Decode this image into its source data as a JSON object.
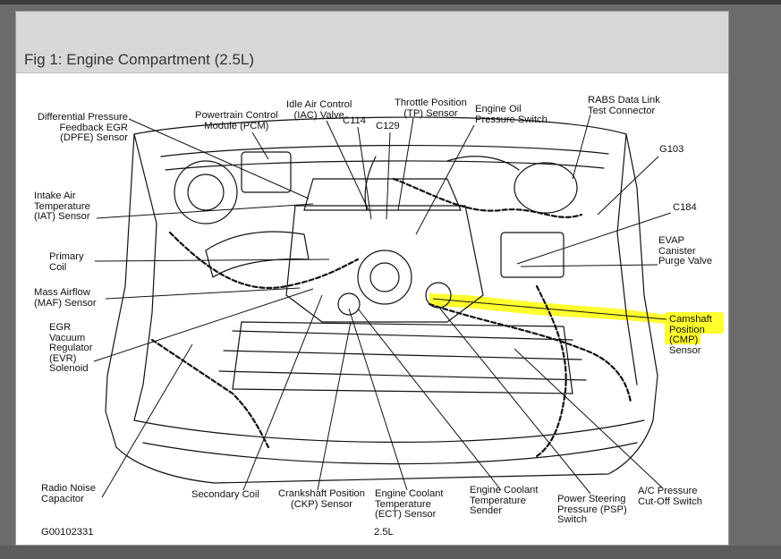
{
  "figure": {
    "title": "Fig 1: Engine Compartment (2.5L)",
    "code": "G00102331",
    "engine": "2.5L"
  },
  "labels": {
    "dpfe": "Differential Pressure\nFeedback EGR\n(DPFE) Sensor",
    "pcm": "Powertrain Control\nModule (PCM)",
    "iac": "Idle Air Control\n(IAC) Valve",
    "c114": "C114",
    "c129": "C129",
    "tp": "Throttle Position\n(TP) Sensor",
    "oil": "Engine Oil\nPressure Switch",
    "rabs": "RABS Data Link\nTest Connector",
    "g103": "G103",
    "iat": "Intake Air\nTemperature\n(IAT) Sensor",
    "c184": "C184",
    "evap": "EVAP\nCanister\nPurge Valve",
    "coil": "Primary\nCoil",
    "maf": "Mass Airflow\n(MAF) Sensor",
    "cmp": "Camshaft\nPosition\n(CMP)\nSensor",
    "egr": "EGR\nVacuum\nRegulator\n(EVR)\nSolenoid",
    "radio": "Radio Noise\nCapacitor",
    "secondary": "Secondary Coil",
    "ckp": "Crankshaft Position\n(CKP) Sensor",
    "ect": "Engine Coolant\nTemperature\n(ECT) Sensor",
    "sender": "Engine Coolant\nTemperature\nSender",
    "psp": "Power Steering\nPressure (PSP)\nSwitch",
    "ac": "A/C Pressure\nCut-Off Switch"
  },
  "colors": {
    "highlight": "#ffff2e",
    "header": "#d8d8d8",
    "line": "#111111"
  }
}
